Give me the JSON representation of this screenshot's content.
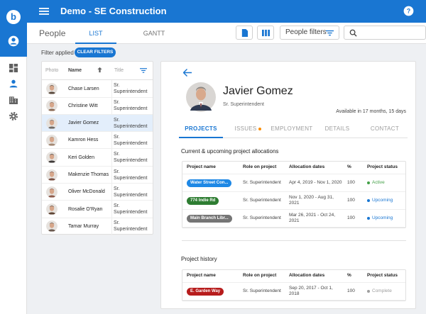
{
  "app": {
    "logo": "b",
    "title": "Demo - SE Construction"
  },
  "rail": {
    "icons": [
      "user-icon",
      "dashboard-icon",
      "person-icon",
      "building-icon",
      "gear-icon"
    ]
  },
  "subbar": {
    "page_title": "People",
    "tabs": [
      {
        "label": "LIST",
        "active": true
      },
      {
        "label": "GANTT",
        "active": false
      }
    ],
    "people_filters_label": "People filters",
    "search_placeholder": ""
  },
  "filter": {
    "applied_label": "Filter applied",
    "clear_label": "CLEAR FILTERS"
  },
  "people_list": {
    "headers": {
      "photo": "Photo",
      "name": "Name",
      "title": "Title"
    },
    "rows": [
      {
        "name": "Chase Larsen",
        "title": "Sr. Superintendent",
        "avatar_color": "#5a4a3e"
      },
      {
        "name": "Christine Witt",
        "title": "Sr. Superintendent",
        "avatar_color": "#8b6a55"
      },
      {
        "name": "Javier Gomez",
        "title": "Sr. Superintendent",
        "avatar_color": "#6f6a66",
        "selected": true
      },
      {
        "name": "Kamron Hess",
        "title": "Sr. Superintendent",
        "avatar_color": "#a38873"
      },
      {
        "name": "Keri Golden",
        "title": "Sr. Superintendent",
        "avatar_color": "#3f3a38"
      },
      {
        "name": "Makenzie Thomas",
        "title": "Sr. Superintendent",
        "avatar_color": "#7a4f42"
      },
      {
        "name": "Oliver McDonald",
        "title": "Sr. Superintendent",
        "avatar_color": "#8e5c4c"
      },
      {
        "name": "Rosalie O'Ryan",
        "title": "Sr. Superintendent",
        "avatar_color": "#5f4535"
      },
      {
        "name": "Tamar Murray",
        "title": "Sr. Superintendent",
        "avatar_color": "#6b5a4f"
      }
    ]
  },
  "detail": {
    "name": "Javier Gomez",
    "role": "Sr. Superintendent",
    "availability": "Available in 17 months, 15 days",
    "avatar_color": "#6f6a66",
    "tabs": [
      {
        "label": "PROJECTS",
        "active": true
      },
      {
        "label": "ISSUES",
        "active": false,
        "dot": true
      },
      {
        "label": "EMPLOYMENT",
        "active": false
      },
      {
        "label": "DETAILS",
        "active": false
      },
      {
        "label": "CONTACT",
        "active": false
      }
    ],
    "current_title": "Current & upcoming project allocations",
    "current_headers": [
      "Project name",
      "Role on project",
      "Allocation dates",
      "%",
      "Project status"
    ],
    "current_rows": [
      {
        "project": "Water Street Con...",
        "chip_color": "#1e88e5",
        "role": "Sr. Superintendent",
        "dates": "Apr 4, 2019 - Nov 1, 2020",
        "pct": "100",
        "status": "Active",
        "status_color": "#43a047"
      },
      {
        "project": "774 Indie Rd",
        "chip_color": "#2e7d32",
        "role": "Sr. Superintendent",
        "dates": "Nov 1, 2020 - Aug 31, 2021",
        "pct": "100",
        "status": "Upcoming",
        "status_color": "#1976d2"
      },
      {
        "project": "Main Branch Libr...",
        "chip_color": "#757575",
        "role": "Sr. Superintendent",
        "dates": "Mar 26, 2021 - Oct 24, 2021",
        "pct": "100",
        "status": "Upcoming",
        "status_color": "#1976d2"
      }
    ],
    "history_title": "Project history",
    "history_headers": [
      "Project name",
      "Role on project",
      "Allocation dates",
      "%",
      "Project status"
    ],
    "history_rows": [
      {
        "project": "E. Garden Way",
        "chip_color": "#b71c1c",
        "role": "Sr. Superintendent",
        "dates": "Sep 20, 2017 - Oct 1, 2018",
        "pct": "100",
        "status": "Complete",
        "status_color": "#9e9e9e"
      }
    ]
  }
}
